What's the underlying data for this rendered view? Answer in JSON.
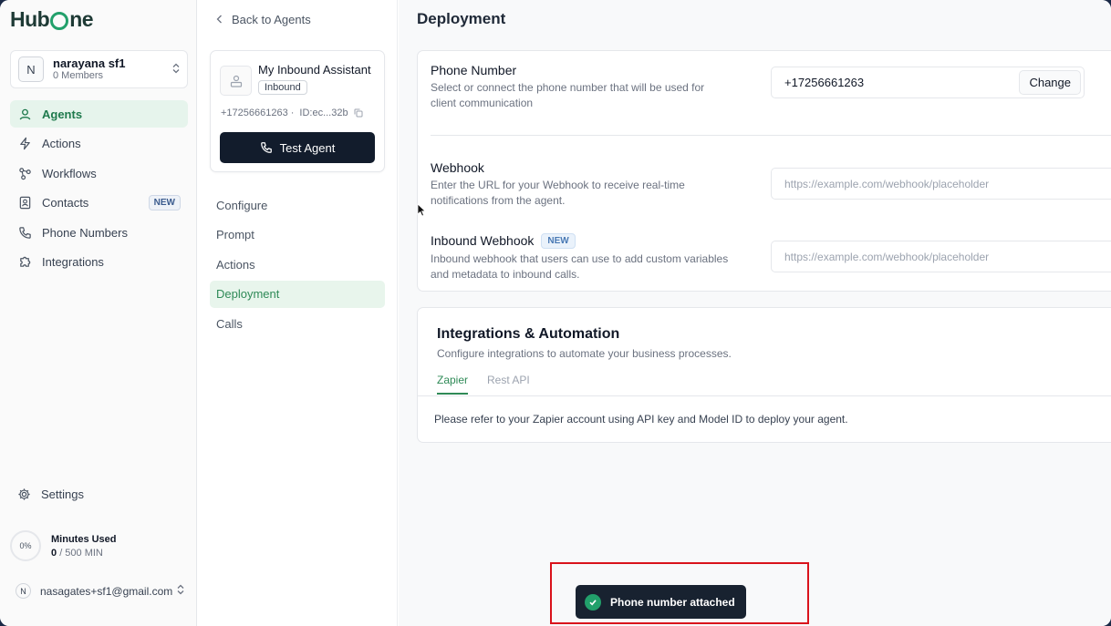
{
  "brand": {
    "logo_pre": "Hub",
    "logo_post": "ne"
  },
  "org": {
    "initial": "N",
    "name": "narayana sf1",
    "members": "0 Members"
  },
  "sidebar": {
    "items": [
      {
        "label": "Agents",
        "icon": "user-icon"
      },
      {
        "label": "Actions",
        "icon": "bolt-icon"
      },
      {
        "label": "Workflows",
        "icon": "workflow-icon"
      },
      {
        "label": "Contacts",
        "icon": "contacts-icon",
        "badge": "NEW"
      },
      {
        "label": "Phone Numbers",
        "icon": "phone-icon"
      },
      {
        "label": "Integrations",
        "icon": "puzzle-icon"
      }
    ],
    "settings_label": "Settings",
    "minutes": {
      "percent": "0%",
      "title": "Minutes Used",
      "used": "0",
      "total": "/ 500 MIN"
    },
    "user": {
      "initial": "N",
      "email": "nasagates+sf1@gmail.com"
    }
  },
  "agent": {
    "back_label": "Back to Agents",
    "name": "My Inbound Assistant",
    "tag": "Inbound",
    "phone": "+17256661263",
    "id": "ID:ec...32b",
    "test_label": "Test Agent",
    "menu": [
      "Configure",
      "Prompt",
      "Actions",
      "Deployment",
      "Calls"
    ]
  },
  "main": {
    "title": "Deployment",
    "phone": {
      "title": "Phone Number",
      "desc": "Select or connect the phone number that will be used for client communication",
      "value": "+17256661263",
      "change_label": "Change"
    },
    "webhook": {
      "title": "Webhook",
      "desc": "Enter the URL for your Webhook to receive real-time notifications from the agent.",
      "placeholder": "https://example.com/webhook/placeholder"
    },
    "inbound_webhook": {
      "title": "Inbound Webhook",
      "badge": "NEW",
      "desc": "Inbound webhook that users can use to add custom variables and metadata to inbound calls.",
      "placeholder": "https://example.com/webhook/placeholder"
    },
    "integrations": {
      "title": "Integrations & Automation",
      "desc": "Configure integrations to automate your business processes.",
      "tabs": [
        "Zapier",
        "Rest API"
      ],
      "body": "Please refer to your Zapier account using API key and Model ID to deploy your agent."
    }
  },
  "toast": {
    "message": "Phone number attached"
  },
  "colors": {
    "accent": "#22a06b",
    "dark_button": "#121c2c",
    "toast_bg": "#182230",
    "highlight": "#d9121b"
  }
}
